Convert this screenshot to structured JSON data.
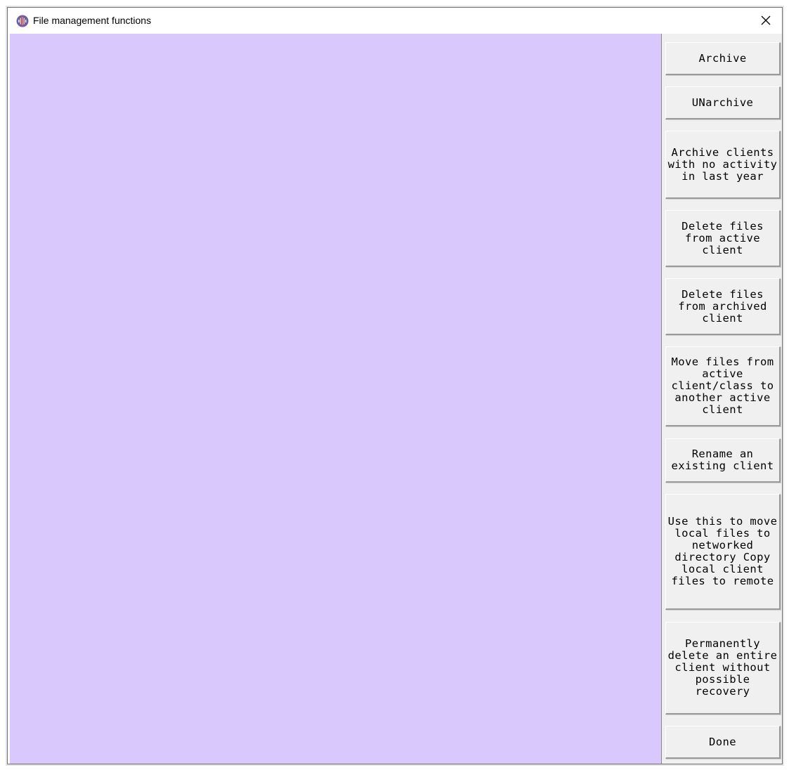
{
  "window": {
    "title": "File management functions",
    "app_icon": "waveform-app-icon",
    "close_icon": "close-icon"
  },
  "canvas": {
    "background": "#d9c8fc"
  },
  "side_panel": {
    "buttons": {
      "archive": "Archive",
      "unarchive": "UNarchive",
      "archive_no_activity": "Archive clients with no activity in last year",
      "delete_active": "Delete files from active client",
      "delete_archived": "Delete files from archived client",
      "move_files": "Move files from active client/class to another active client",
      "rename_client": "Rename an existing client",
      "move_to_network": "Use this to move local files to networked directory Copy local client files to remote",
      "permanently_delete": "Permanently delete an entire client without possible recovery",
      "done": "Done"
    }
  }
}
